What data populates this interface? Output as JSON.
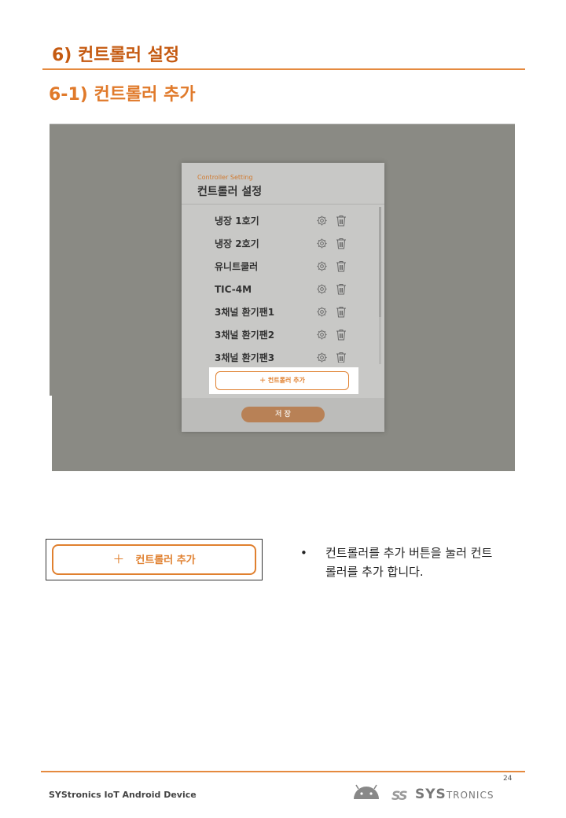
{
  "heading": "6) 컨트롤러 설정",
  "subheading": "6-1)  컨트롤러 추가",
  "dialog": {
    "subtitle": "Controller Setting",
    "title": "컨트롤러 설정",
    "items": [
      {
        "label": "냉장 1호기"
      },
      {
        "label": "냉장 2호기"
      },
      {
        "label": "유니트쿨러"
      },
      {
        "label": "TIC-4M"
      },
      {
        "label": "3채널 환기팬1"
      },
      {
        "label": "3채널 환기팬2"
      },
      {
        "label": "3채널 환기팬3"
      }
    ],
    "add_button": "＋  컨트롤러 추가",
    "save_button": "저 장"
  },
  "enlarged_button": {
    "plus": "＋",
    "label": "컨트롤러 추가"
  },
  "description": {
    "bullet": "•",
    "text": "컨트롤러를 추가 버튼을 눌러 컨트롤러를 추가 합니다."
  },
  "footer": {
    "page_number": "24",
    "company_text": "SYStronics IoT Android Device",
    "logo_mark": "SS",
    "logo_big": "SYS",
    "logo_small": "TRONICS"
  },
  "colors": {
    "accent": "#e0802f",
    "heading": "#c55a11"
  }
}
